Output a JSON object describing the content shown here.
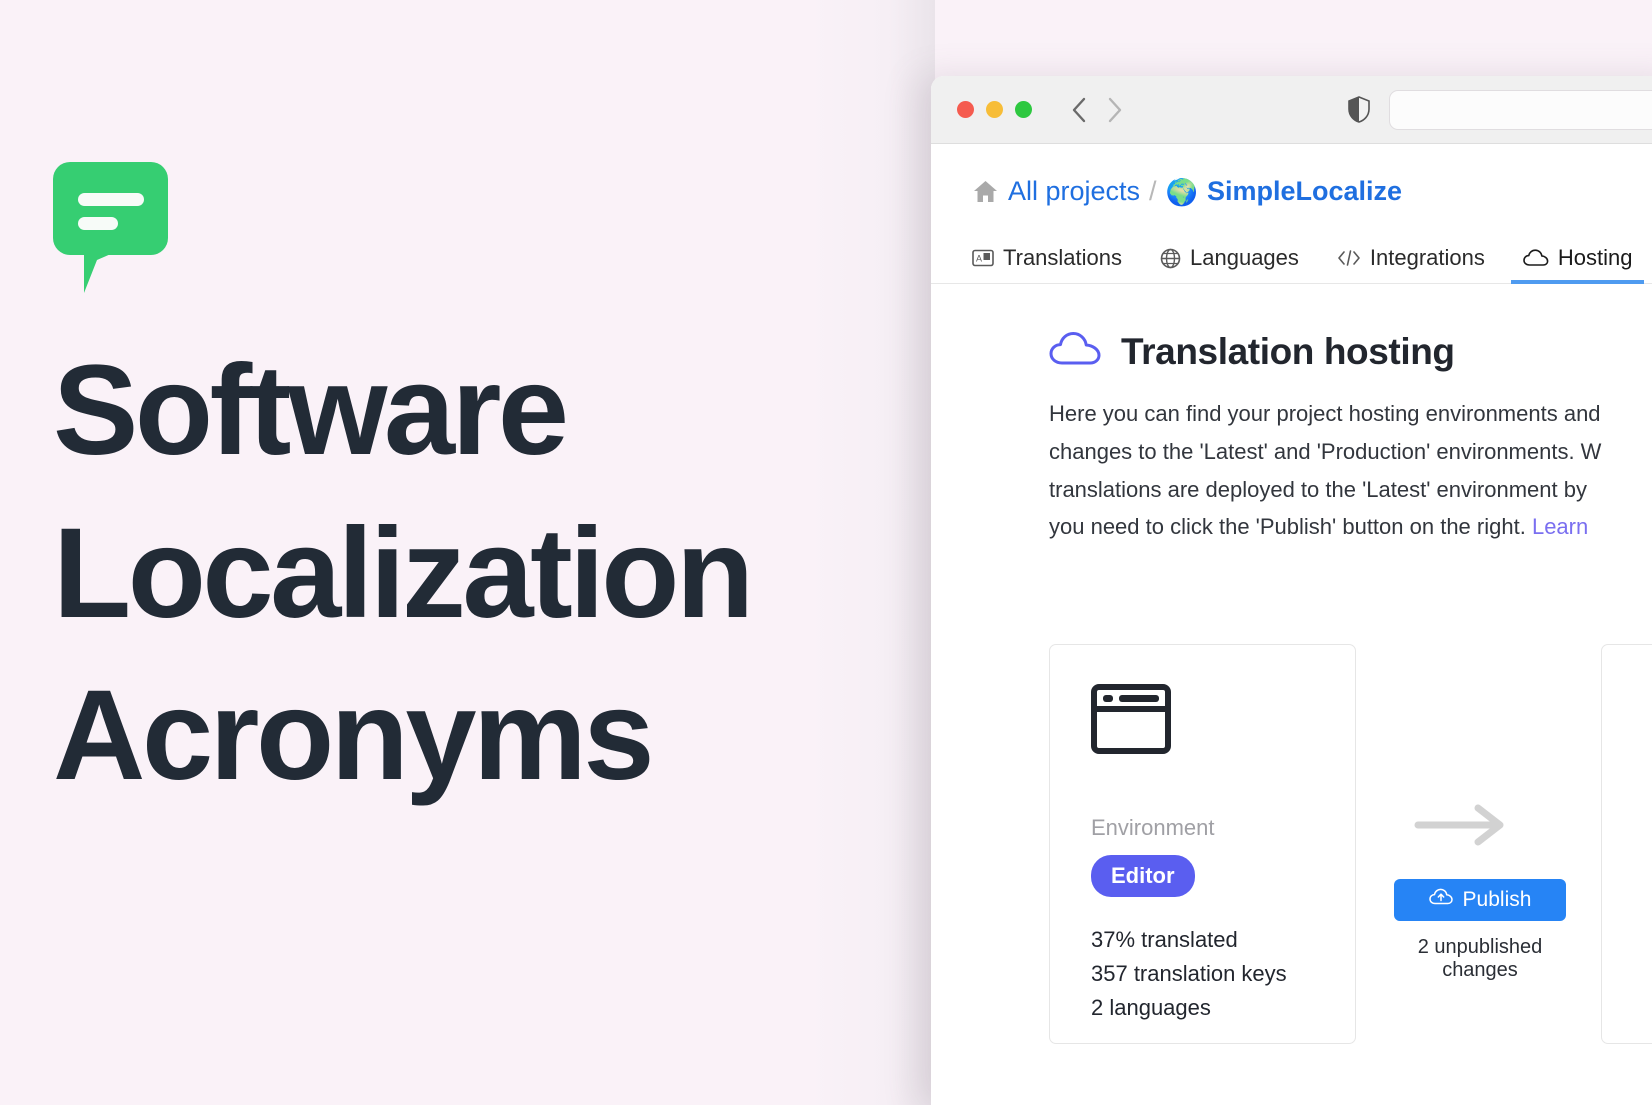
{
  "hero": {
    "logo_icon": "speech-bubble-icon",
    "logo_color": "#36ce72",
    "headline_lines": [
      "Software",
      "Localization",
      "Acronyms"
    ],
    "text_color": "#222b36",
    "background_color": "#faf2f8"
  },
  "browser": {
    "traffic_lights": [
      "close-red",
      "minimize-yellow",
      "maximize-green"
    ],
    "back_icon": "chevron-left-icon",
    "forward_icon": "chevron-right-icon",
    "shield_icon": "shield-icon",
    "url_value": "",
    "url_placeholder": ""
  },
  "breadcrumb": {
    "home_icon": "home-icon",
    "all_projects": "All projects",
    "separator": "/",
    "globe_icon": "🌍",
    "current_project": "SimpleLocalize"
  },
  "tabs": [
    {
      "label": "Translations",
      "icon": "translate-icon",
      "active": false
    },
    {
      "label": "Languages",
      "icon": "globe-icon",
      "active": false
    },
    {
      "label": "Integrations",
      "icon": "code-icon",
      "active": false
    },
    {
      "label": "Hosting",
      "icon": "cloud-icon",
      "active": true
    }
  ],
  "main": {
    "section_icon": "cloud-icon",
    "section_icon_color": "#5a5ef0",
    "title": "Translation hosting",
    "description_lines": [
      "Here you can find your project hosting environments and",
      "changes to the 'Latest' and 'Production' environments. W",
      "translations are deployed to the 'Latest' environment by",
      "you need to click the 'Publish' button on the right."
    ],
    "description_link": "Learn",
    "link_color": "#7a6ff0"
  },
  "env_card": {
    "icon": "browser-window-icon",
    "label": "Environment",
    "badge": "Editor",
    "badge_color": "#5a5ef0",
    "stats": [
      "37% translated",
      "357 translation keys",
      "2 languages"
    ]
  },
  "publish": {
    "arrow_icon": "arrow-right-icon",
    "button_label": "Publish",
    "button_icon": "cloud-upload-icon",
    "button_color": "#2684f5",
    "note": "2 unpublished changes"
  }
}
